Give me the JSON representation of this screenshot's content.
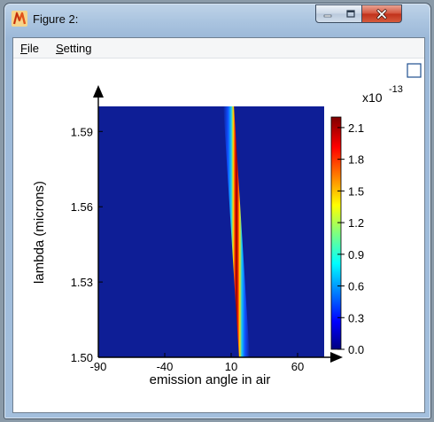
{
  "window": {
    "title": "Figure 2:"
  },
  "menu": {
    "items": [
      {
        "label": "File",
        "accel": "F",
        "rest": "ile"
      },
      {
        "label": "Setting",
        "accel": "S",
        "rest": "etting"
      }
    ]
  },
  "chart_data": {
    "type": "heatmap",
    "xlabel": "emission angle in air",
    "ylabel": "lambda (microns)",
    "xticks": [
      "-90",
      "-40",
      "10",
      "60"
    ],
    "yticks": [
      "1.50",
      "1.53",
      "1.56",
      "1.59"
    ],
    "xlim": [
      -90,
      80
    ],
    "ylim": [
      1.5,
      1.6
    ],
    "ridge": {
      "x_at_ymin": 20,
      "x_at_ymax": 8,
      "description_values": [
        [
          8,
          1.6
        ],
        [
          20,
          1.5
        ]
      ]
    },
    "colorbar": {
      "exponent": "x10",
      "exponent_power": "-13",
      "ticks": [
        "2.1",
        "1.8",
        "1.5",
        "1.2",
        "0.9",
        "0.6",
        "0.3",
        "0.0"
      ],
      "range": [
        0,
        2.2
      ]
    },
    "colors": {
      "background": "#0e1e96",
      "peak": "#800000"
    }
  }
}
